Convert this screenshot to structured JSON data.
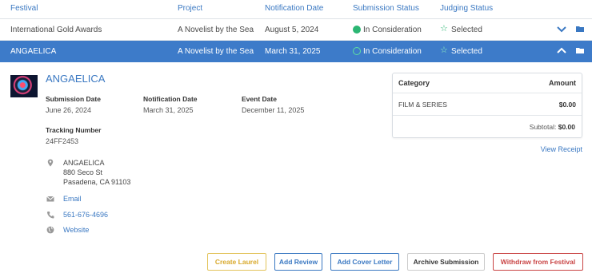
{
  "table_header": {
    "festival": "Festival",
    "project": "Project",
    "notification_date": "Notification Date",
    "submission_status": "Submission Status",
    "judging_status": "Judging Status"
  },
  "rows": [
    {
      "festival": "International Gold Awards",
      "project": "A Novelist by the Sea",
      "notification_date": "August 5, 2024",
      "submission_status": "In Consideration",
      "judging_status": "Selected",
      "expanded": false
    },
    {
      "festival": "ANGAELICA",
      "project": "A Novelist by the Sea",
      "notification_date": "March 31, 2025",
      "submission_status": "In Consideration",
      "judging_status": "Selected",
      "expanded": true
    }
  ],
  "detail": {
    "title": "ANGAELICA",
    "submission_date_label": "Submission Date",
    "submission_date": "June 26, 2024",
    "notification_date_label": "Notification Date",
    "notification_date": "March 31, 2025",
    "event_date_label": "Event Date",
    "event_date": "December 11, 2025",
    "tracking_label": "Tracking Number",
    "tracking_number": "24FF2453",
    "address_name": "ANGAELICA",
    "address_street": "880 Seco St",
    "address_city": "Pasadena, CA 91103",
    "email_label": "Email",
    "phone": "561-676-4696",
    "website_label": "Website"
  },
  "fees": {
    "category_label": "Category",
    "amount_label": "Amount",
    "category": "FILM & SERIES",
    "amount": "$0.00",
    "subtotal_label": "Subtotal:",
    "subtotal": "$0.00",
    "view_receipt": "View Receipt"
  },
  "actions": {
    "create_laurel": "Create Laurel",
    "add_review": "Add Review",
    "add_cover_letter": "Add Cover Letter",
    "archive_submission": "Archive Submission",
    "withdraw": "Withdraw from Festival"
  },
  "colors": {
    "accent": "#3d7bc9",
    "status_green": "#2bb673",
    "danger": "#c94444",
    "gold": "#d8a92c"
  },
  "icons": [
    "check-circle-icon",
    "star-icon",
    "chevron-down-icon",
    "chevron-up-icon",
    "folder-icon",
    "map-pin-icon",
    "mail-icon",
    "phone-icon",
    "globe-icon"
  ]
}
